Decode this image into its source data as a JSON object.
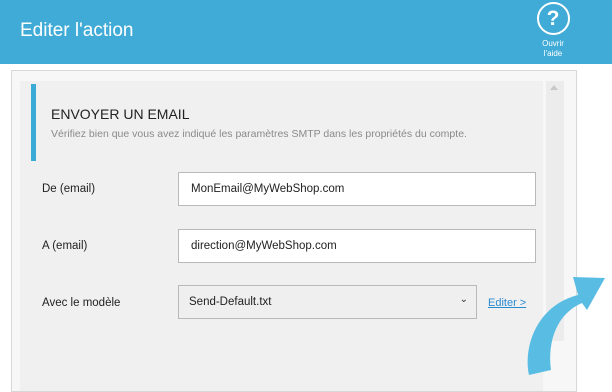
{
  "header": {
    "title": "Editer l'action",
    "help_icon": "question-circle-icon",
    "help_glyph": "?",
    "help_label_line1": "Ouvrir",
    "help_label_line2": "l'aide"
  },
  "section": {
    "title": "ENVOYER UN EMAIL",
    "subtitle": "Vérifiez bien que vous avez indiqué les paramètres SMTP dans les propriétés du compte."
  },
  "form": {
    "from_label": "De (email)",
    "from_value": "MonEmail@MyWebShop.com",
    "to_label": "A (email)",
    "to_value": "direction@MyWebShop.com",
    "template_label": "Avec le modèle",
    "template_value": "Send-Default.txt",
    "edit_link": "Editer >"
  },
  "colors": {
    "header_bg": "#40abd6",
    "accent": "#3aaad6",
    "link": "#2a8ad0"
  }
}
